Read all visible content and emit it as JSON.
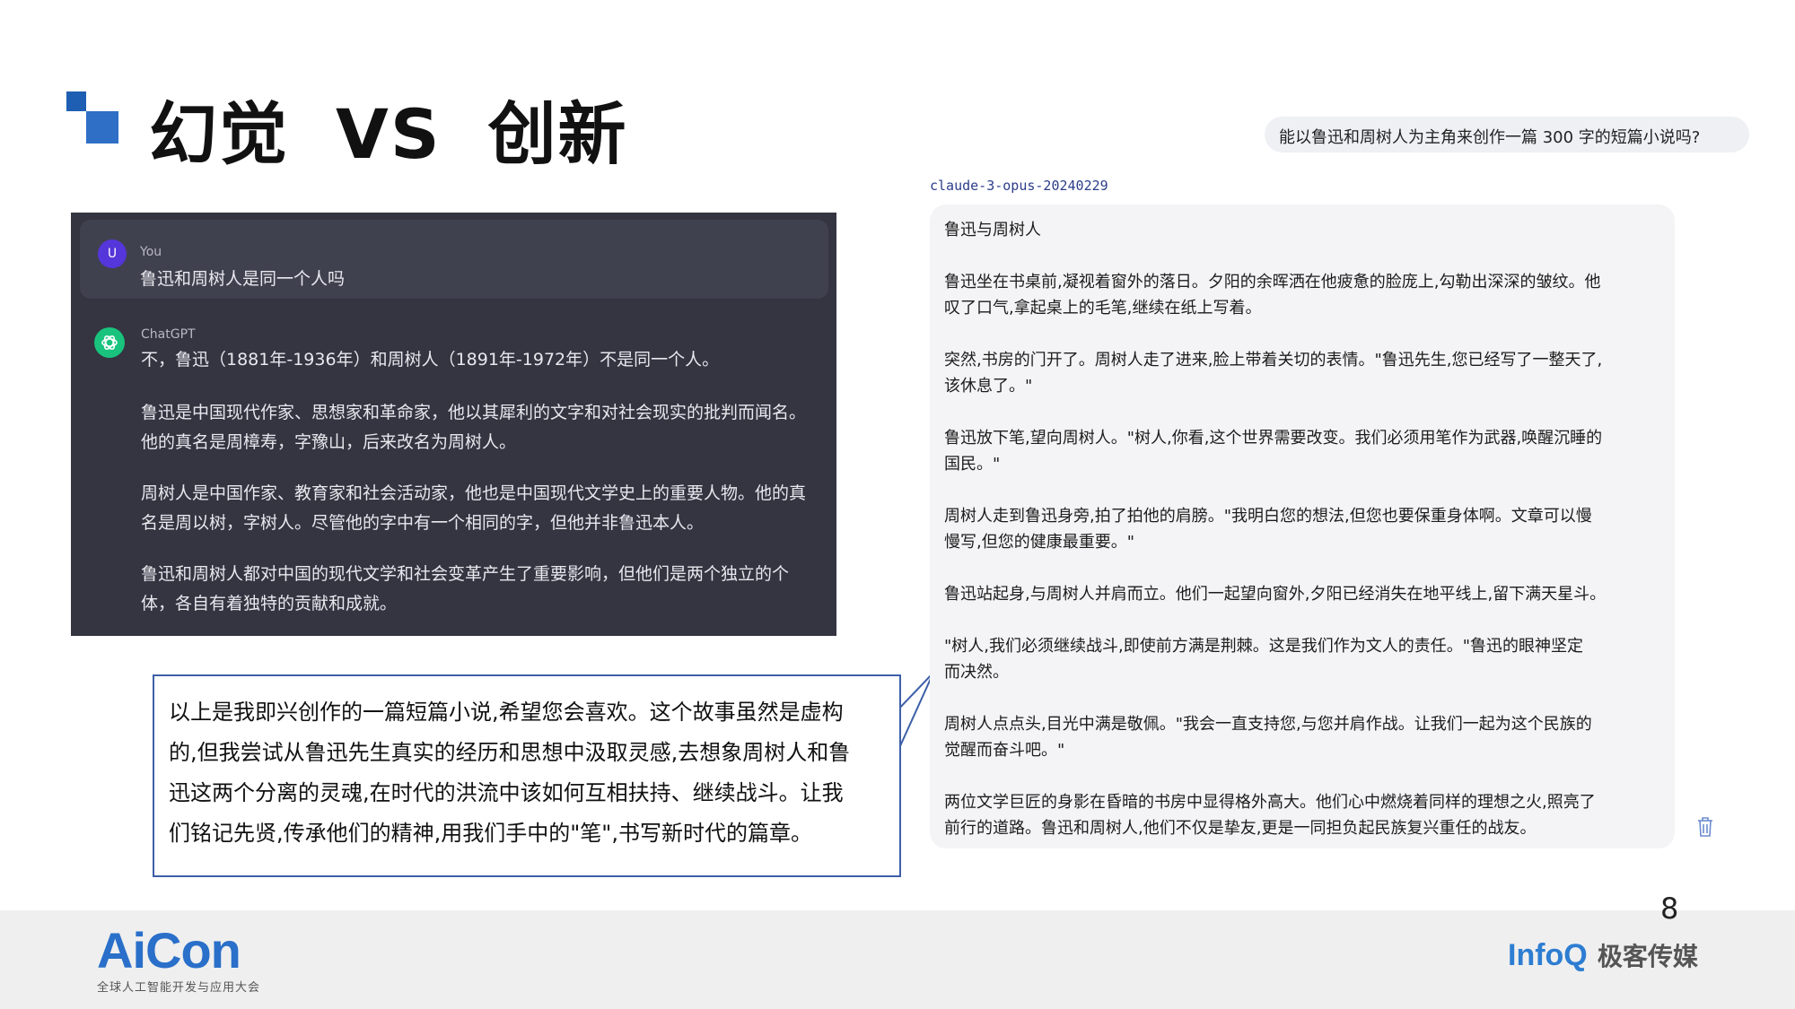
{
  "title": {
    "part1": "幻觉",
    "part2": "VS",
    "part3": "创新"
  },
  "chatgpt": {
    "user_avatar": "U",
    "user_name": "You",
    "user_message": "鲁迅和周树人是同一个人吗",
    "bot_name": "ChatGPT",
    "reply_lines": [
      "不，鲁迅（1881年-1936年）和周树人（1891年-1972年）不是同一个人。",
      "鲁迅是中国现代作家、思想家和革命家，他以其犀利的文字和对社会现实的批判而闻名。",
      "他的真名是周樟寿，字豫山，后来改名为周树人。",
      "周树人是中国作家、教育家和社会活动家，他也是中国现代文学史上的重要人物。他的真",
      "名是周以树，字树人。尽管他的字中有一个相同的字，但他并非鲁迅本人。",
      "鲁迅和周树人都对中国的现代文学和社会变革产生了重要影响，但他们是两个独立的个",
      "体，各自有着独特的贡献和成就。"
    ]
  },
  "callout": {
    "lines": [
      "以上是我即兴创作的一篇短篇小说,希望您会喜欢。这个故事虽然是虚构",
      "的,但我尝试从鲁迅先生真实的经历和思想中汲取灵感,去想象周树人和鲁",
      "迅这两个分离的灵魂,在时代的洪流中该如何互相扶持、继续战斗。让我",
      "们铭记先贤,传承他们的精神,用我们手中的\"笔\",书写新时代的篇章。"
    ]
  },
  "question": "能以鲁迅和周树人为主角来创作一篇 300 字的短篇小说吗?",
  "model_label": "claude-3-opus-20240229",
  "story": {
    "lines": [
      "鲁迅与周树人",
      "鲁迅坐在书桌前,凝视着窗外的落日。夕阳的余晖洒在他疲惫的脸庞上,勾勒出深深的皱纹。他",
      "叹了口气,拿起桌上的毛笔,继续在纸上写着。",
      "突然,书房的门开了。周树人走了进来,脸上带着关切的表情。\"鲁迅先生,您已经写了一整天了,",
      "该休息了。\"",
      "鲁迅放下笔,望向周树人。\"树人,你看,这个世界需要改变。我们必须用笔作为武器,唤醒沉睡的",
      "国民。\"",
      "周树人走到鲁迅身旁,拍了拍他的肩膀。\"我明白您的想法,但您也要保重身体啊。文章可以慢",
      "慢写,但您的健康最重要。\"",
      "鲁迅站起身,与周树人并肩而立。他们一起望向窗外,夕阳已经消失在地平线上,留下满天星斗。",
      "\"树人,我们必须继续战斗,即使前方满是荆棘。这是我们作为文人的责任。\"鲁迅的眼神坚定",
      "而决然。",
      "周树人点点头,目光中满是敬佩。\"我会一直支持您,与您并肩作战。让我们一起为这个民族的",
      "觉醒而奋斗吧。\"",
      "两位文学巨匠的身影在昏暗的书房中显得格外高大。他们心中燃烧着同样的理想之火,照亮了",
      "前行的道路。鲁迅和周树人,他们不仅是挚友,更是一同担负起民族复兴重任的战友。"
    ]
  },
  "page_number": "8",
  "footer": {
    "aicon": "AiCon",
    "aicon_sub": "全球人工智能开发与应用大会",
    "infoq": "InfoQ",
    "infoq_cn": "极客传媒"
  }
}
